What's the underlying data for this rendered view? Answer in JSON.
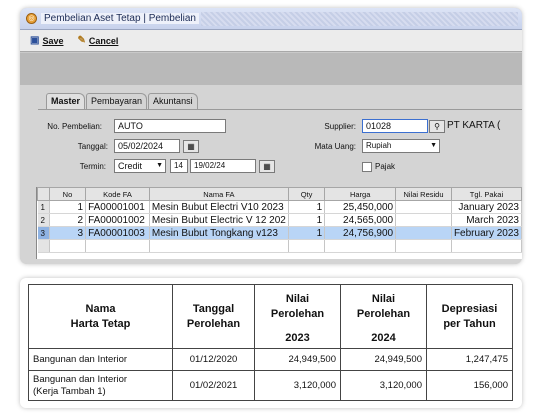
{
  "window": {
    "title": "Pembelian Aset Tetap | Pembelian"
  },
  "toolbar": {
    "save": "Save",
    "cancel": "Cancel"
  },
  "tabs": [
    "Master",
    "Pembayaran",
    "Akuntansi"
  ],
  "form": {
    "no_pembelian_label": "No. Pembelian:",
    "no_pembelian": "AUTO",
    "tanggal_label": "Tanggal:",
    "tanggal": "05/02/2024",
    "termin_label": "Termin:",
    "termin": "Credit",
    "termin_days": "14",
    "termin_date": "19/02/24",
    "supplier_label": "Supplier:",
    "supplier_code": "01028",
    "supplier_name": "PT KARTA (",
    "mata_uang_label": "Mata Uang:",
    "mata_uang": "Rupiah",
    "pajak_label": "Pajak"
  },
  "grid": {
    "columns": [
      "No",
      "Kode FA",
      "Nama FA",
      "Qty",
      "Harga",
      "Nilai Residu",
      "Tgl. Pakai"
    ],
    "rows": [
      {
        "rn": "1",
        "no": "1",
        "kode": "FA00001001",
        "nama": "Mesin Bubut Electri V10 2023",
        "qty": "1",
        "harga": "25,450,000",
        "residu": "",
        "tgl": "January 2023"
      },
      {
        "rn": "2",
        "no": "2",
        "kode": "FA00001002",
        "nama": "Mesin Bubut Electric V 12 202",
        "qty": "1",
        "harga": "24,565,000",
        "residu": "",
        "tgl": "March 2023"
      },
      {
        "rn": "3",
        "no": "3",
        "kode": "FA00001003",
        "nama": "Mesin Bubut Tongkang v123",
        "qty": "1",
        "harga": "24,756,900",
        "residu": "",
        "tgl": "February 2023"
      }
    ]
  },
  "sheet": {
    "headers": {
      "nama": "Nama\nHarta Tetap",
      "tanggal": "Tanggal\nPerolehan",
      "nilai": "Nilai\nPerolehan",
      "year1": "2023",
      "year2": "2024",
      "depresiasi": "Depresiasi\nper Tahun"
    },
    "rows": [
      {
        "nama": "Bangunan dan Interior",
        "tanggal": "01/12/2020",
        "v2023": "24,949,500",
        "v2024": "24,949,500",
        "dep": "1,247,475"
      },
      {
        "nama": "Bangunan dan Interior\n(Kerja Tambah 1)",
        "tanggal": "01/02/2021",
        "v2023": "3,120,000",
        "v2024": "3,120,000",
        "dep": "156,000"
      }
    ]
  },
  "colors": {
    "selected_row": "#b9d5f6",
    "title_bar": "#c8d2ec",
    "panel": "#d4d4d4"
  },
  "icons": [
    "window-icon",
    "save-icon",
    "cancel-icon",
    "calendar-icon",
    "search-icon",
    "dropdown-arrow-icon"
  ]
}
